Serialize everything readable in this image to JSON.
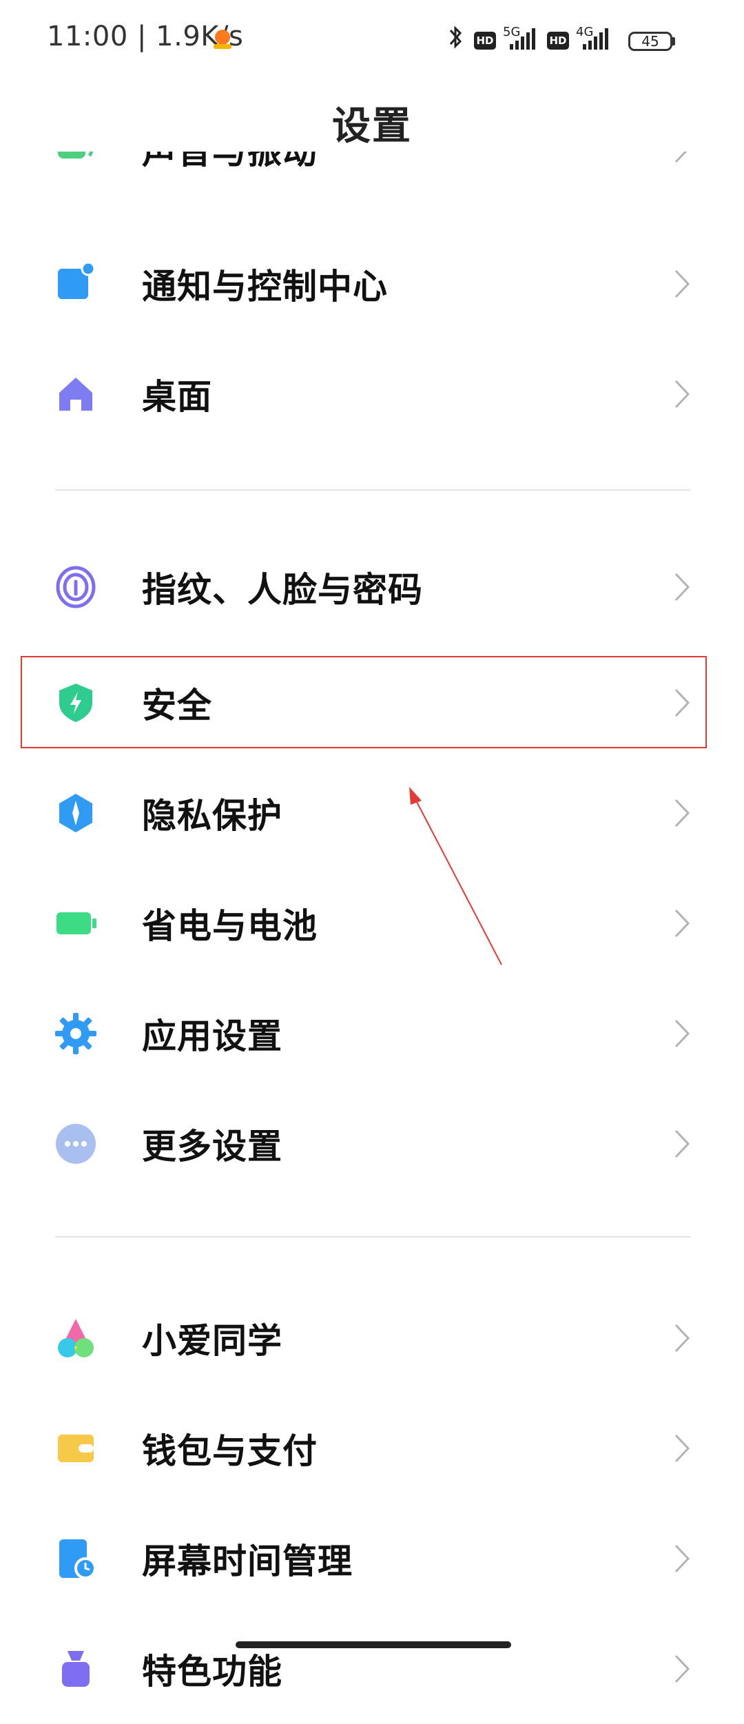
{
  "status_bar": {
    "time": "11:00 | 1.9K/s",
    "net1": "5G",
    "net2": "4G",
    "hd": "HD",
    "battery": "45"
  },
  "header": {
    "title": "设置"
  },
  "items": {
    "sound": "声音与振动",
    "notifications": "通知与控制中心",
    "home_screen": "桌面",
    "fingerprint": "指纹、人脸与密码",
    "security": "安全",
    "privacy": "隐私保护",
    "battery": "省电与电池",
    "apps": "应用设置",
    "more": "更多设置",
    "xiaoai": "小爱同学",
    "wallet": "钱包与支付",
    "screen_time": "屏幕时间管理",
    "special": "特色功能"
  },
  "colors": {
    "highlight": "#e53935",
    "accent_blue": "#2f9bf5",
    "accent_green": "#2ecc71"
  },
  "icons": {
    "sound": "sound-icon",
    "notifications": "notification-icon",
    "home_screen": "home-icon",
    "fingerprint": "fingerprint-icon",
    "security": "shield-icon",
    "privacy": "privacy-icon",
    "battery": "battery-icon",
    "apps": "gear-icon",
    "more": "more-icon",
    "xiaoai": "xiaoai-icon",
    "wallet": "wallet-icon",
    "screen_time": "screen-time-icon",
    "special": "special-feature-icon"
  }
}
